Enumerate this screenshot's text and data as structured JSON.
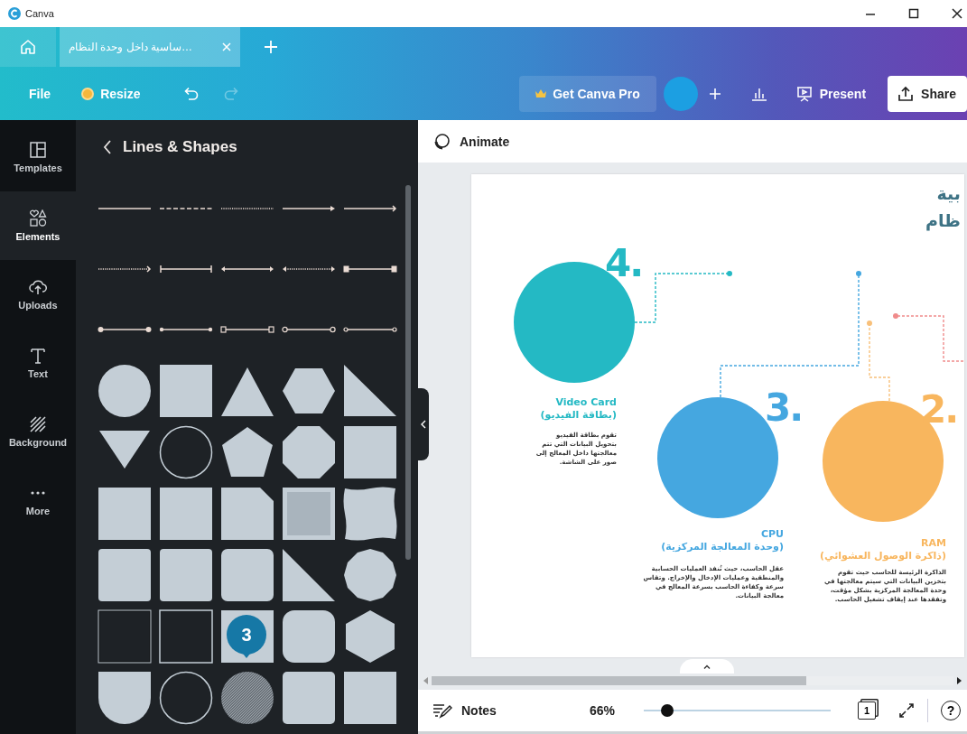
{
  "window": {
    "title": "Canva"
  },
  "tabs": [
    {
      "label": "…ساسية داخل وحدة النظام",
      "selected": true
    }
  ],
  "toolbar": {
    "file": "File",
    "resize": "Resize",
    "undo": {
      "disabled": false
    },
    "redo": {
      "disabled": true
    },
    "upgrade": "Get Canva Pro",
    "present": "Present",
    "share": "Share"
  },
  "rail": [
    {
      "label": "Templates",
      "selected": false
    },
    {
      "label": "Elements",
      "selected": true
    },
    {
      "label": "Uploads",
      "selected": false
    },
    {
      "label": "Text",
      "selected": false
    },
    {
      "label": "Background",
      "selected": false
    },
    {
      "label": "More",
      "selected": false
    }
  ],
  "panel": {
    "title": "Lines & Shapes"
  },
  "callout_badge": "3",
  "editor": {
    "animate": "Animate"
  },
  "slide": {
    "title_lines": [
      "بية",
      "ظام"
    ],
    "items": [
      {
        "number": "2.",
        "heading": "RAM",
        "subheading": "(ذاكرة الوصول العشوائي)",
        "body": "الذاكرة الرئيسة للحاسب حيث تقوم بتخزين البيانات التي سيتم معالجتها في وحدة المعالجة المركزية بشكل مؤقت، وتفقدها عند إيقاف تشغيل الحاسب.",
        "color": "#f8b65e"
      },
      {
        "number": "3.",
        "heading": "CPU",
        "subheading": "(وحدة المعالجة المركزية)",
        "body": "عقل الحاسب، حيث تُنفذ العمليات الحسابية والمنطقية وعمليات الإدخال والإخراج. وتقاس سرعة وكفاءة الحاسب بسرعة المعالج في معالجة البيانات.",
        "color": "#45a7e0"
      },
      {
        "number": "4.",
        "heading": "Video Card",
        "subheading": "(بطاقة الفيديو)",
        "body": "تقوم بطاقة الفيديو بتحويل البيانات التي تتم معالجتها داخل المعالج إلى صور على الشاشة.",
        "color": "#24b9c4"
      }
    ]
  },
  "footer": {
    "notes": "Notes",
    "zoom": "66%",
    "zoom_slider": {
      "level": 0.1
    },
    "page_number": "1",
    "help": "?"
  }
}
